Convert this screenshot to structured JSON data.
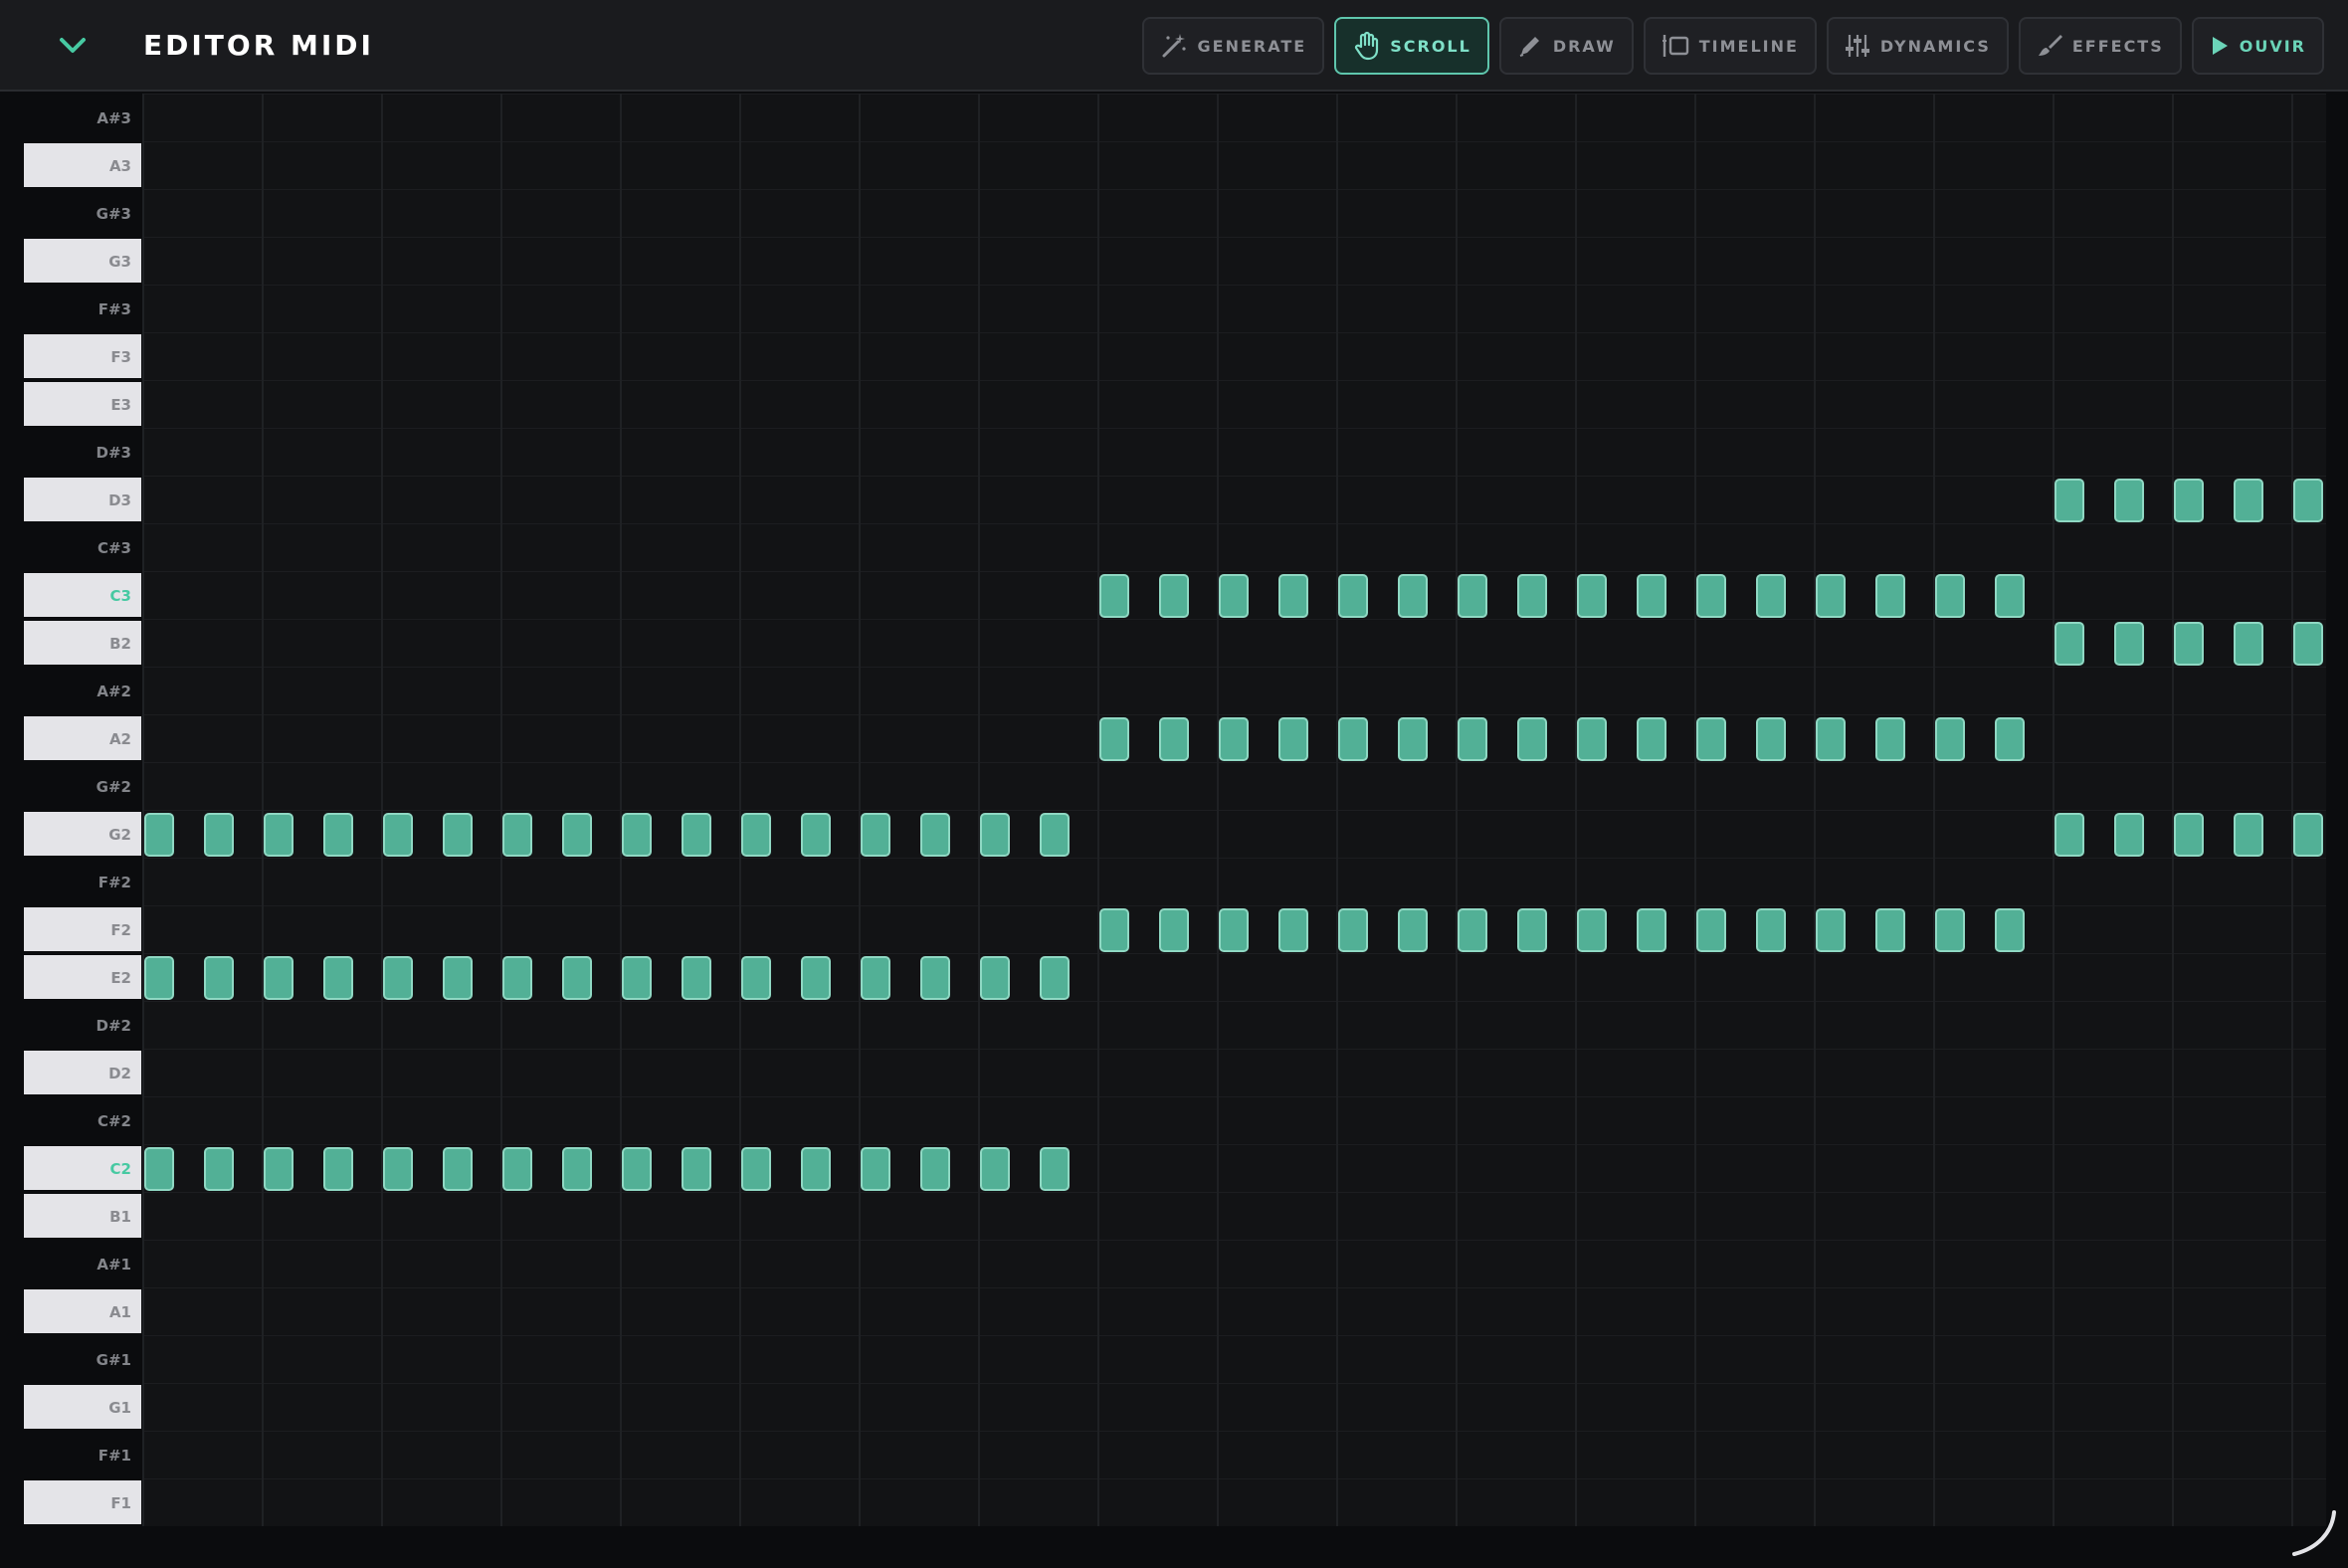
{
  "header": {
    "title": "EDITOR MIDI",
    "tools": [
      {
        "id": "generate",
        "label": "GENERATE",
        "icon": "magic-wand-icon",
        "active": false
      },
      {
        "id": "scroll",
        "label": "SCROLL",
        "icon": "hand-icon",
        "active": true
      },
      {
        "id": "draw",
        "label": "DRAW",
        "icon": "pencil-icon",
        "active": false
      },
      {
        "id": "timeline",
        "label": "TIMELINE",
        "icon": "timeline-icon",
        "active": false
      },
      {
        "id": "dynamics",
        "label": "DYNAMICS",
        "icon": "sliders-icon",
        "active": false
      },
      {
        "id": "effects",
        "label": "EFFECTS",
        "icon": "brush-icon",
        "active": false
      },
      {
        "id": "play",
        "label": "OUVIR",
        "icon": "play-icon",
        "active": false
      }
    ]
  },
  "piano": {
    "keys": [
      "A#3",
      "A3",
      "G#3",
      "G3",
      "F#3",
      "F3",
      "E3",
      "D#3",
      "D3",
      "C#3",
      "C3",
      "B2",
      "A#2",
      "A2",
      "G#2",
      "G2",
      "F#2",
      "F2",
      "E2",
      "D#2",
      "D2",
      "C#2",
      "C2",
      "B1",
      "A#1",
      "A1",
      "G#1",
      "G1",
      "F#1",
      "F1"
    ]
  },
  "roll": {
    "steps_per_section": 16,
    "sections": [
      {
        "pitches": [
          "G2",
          "E2",
          "C2"
        ],
        "steps": 16
      },
      {
        "pitches": [
          "C3",
          "A2",
          "F2"
        ],
        "steps": 16
      },
      {
        "pitches": [
          "D3",
          "B2",
          "G2"
        ],
        "steps": 5
      }
    ]
  },
  "colors": {
    "accent": "#52b096",
    "accent_border": "#8fd8c3",
    "active_tool": "#7fe0c8",
    "background": "#121315"
  }
}
